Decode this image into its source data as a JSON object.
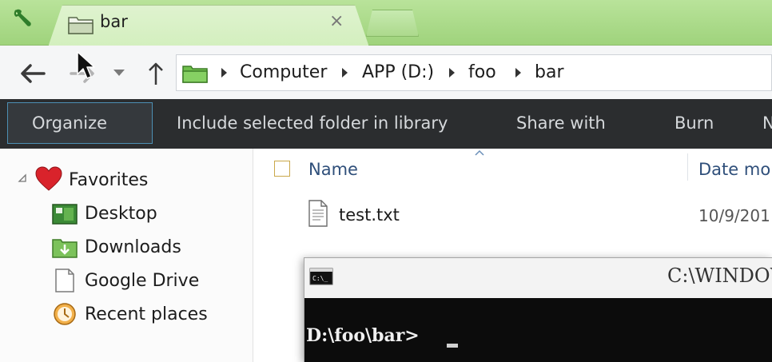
{
  "tab": {
    "title": "bar",
    "close_glyph": "×",
    "icon": "folder-icon"
  },
  "toolbar": {
    "back_icon": "back-arrow-icon",
    "forward_icon": "forward-arrow-icon",
    "recent_icon": "chevron-down-icon",
    "up_icon": "up-arrow-icon"
  },
  "address": {
    "crumbs": [
      "Computer",
      "APP (D:)",
      "foo",
      "bar"
    ]
  },
  "commands": {
    "organize": "Organize",
    "include": "Include selected folder in library",
    "share": "Share with",
    "burn": "Burn",
    "overflow": "N"
  },
  "navpane": {
    "favorites": "Favorites",
    "items": [
      "Desktop",
      "Downloads",
      "Google Drive",
      "Recent places"
    ]
  },
  "filelist": {
    "columns": {
      "name": "Name",
      "date": "Date mo"
    },
    "files": [
      {
        "name": "test.txt",
        "date": "10/9/201"
      }
    ]
  },
  "console": {
    "title": "C:\\WINDOW",
    "prompt": "D:\\foo\\bar>"
  },
  "colors": {
    "tabstrip": "#a8d98a",
    "commandbar": "#2b2d2f",
    "link_text": "#2f4f7a"
  }
}
